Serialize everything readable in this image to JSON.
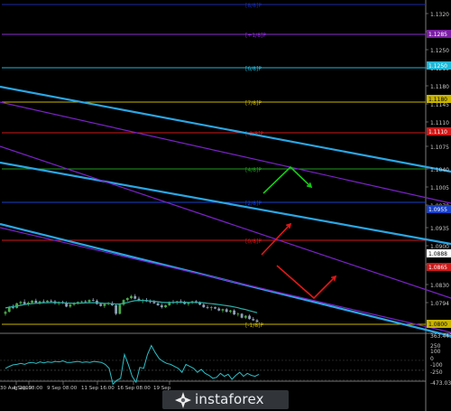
{
  "chart_data": [
    {
      "type": "candlestick",
      "title": "",
      "ylim": [
        1.0794,
        1.3325
      ],
      "price_ticks": [
        "1.1320",
        "1.1285",
        "1.1250",
        "1.1215",
        "1.1180",
        "1.1145",
        "1.1110",
        "1.1075",
        "1.1040",
        "1.1005",
        "1.0970",
        "1.0935",
        "1.0900",
        "1.0865",
        "1.0830",
        "1.0794"
      ],
      "price_marks": [
        {
          "label": "1.1285",
          "color": "#7a1fa2"
        },
        {
          "label": "1.1250",
          "color": "#22b7d6"
        },
        {
          "label": "1.1180",
          "color": "#c8b400"
        },
        {
          "label": "1.1110",
          "color": "#d01818"
        },
        {
          "label": "1.0955",
          "color": "#1740c8"
        },
        {
          "label": "1.0888",
          "color": "#ffffff"
        },
        {
          "label": "1.0865",
          "color": "#d01818"
        },
        {
          "label": "1.0800",
          "color": "#c8b400"
        }
      ],
      "murrey_levels": [
        {
          "label": "[8/8]P",
          "price": 1.3325,
          "color": "#1a2aa0"
        },
        {
          "label": "[+1/8]P",
          "price": 1.1285,
          "color": "#8a2bd0"
        },
        {
          "label": "[6/8]P",
          "price": 1.125,
          "color": "#22b7d6"
        },
        {
          "label": "[7/8]P",
          "price": 1.118,
          "color": "#c8b400"
        },
        {
          "label": "[-2/8]P",
          "price": 1.111,
          "color": "#d01818"
        },
        {
          "label": "[4/8]P",
          "price": 1.104,
          "color": "#1f9a1f"
        },
        {
          "label": "[2/8]P",
          "price": 1.0955,
          "color": "#1740c8"
        },
        {
          "label": "[0/8]P",
          "price": 1.0865,
          "color": "#d01818"
        },
        {
          "label": "[-1/8]P",
          "price": 1.08,
          "color": "#c8b400"
        }
      ],
      "ohlc": [
        [
          1.095,
          1.0975,
          1.0935,
          1.0965
        ],
        [
          1.0965,
          1.101,
          1.096,
          1.1
        ],
        [
          1.1,
          1.102,
          1.0985,
          1.0995
        ],
        [
          1.0995,
          1.1035,
          1.099,
          1.103
        ],
        [
          1.103,
          1.105,
          1.1015,
          1.104
        ],
        [
          1.104,
          1.106,
          1.102,
          1.1025
        ],
        [
          1.1025,
          1.1045,
          1.101,
          1.1035
        ],
        [
          1.1035,
          1.1055,
          1.1025,
          1.105
        ],
        [
          1.105,
          1.1065,
          1.103,
          1.1035
        ],
        [
          1.1035,
          1.105,
          1.102,
          1.1045
        ],
        [
          1.1045,
          1.106,
          1.103,
          1.104
        ],
        [
          1.104,
          1.1055,
          1.1035,
          1.105
        ],
        [
          1.105,
          1.106,
          1.1035,
          1.1045
        ],
        [
          1.1045,
          1.1055,
          1.102,
          1.103
        ],
        [
          1.103,
          1.1045,
          1.1015,
          1.104
        ],
        [
          1.104,
          1.105,
          1.1025,
          1.1035
        ],
        [
          1.1035,
          1.1045,
          1.1,
          1.1005
        ],
        [
          1.1005,
          1.1025,
          1.0995,
          1.102
        ],
        [
          1.102,
          1.104,
          1.101,
          1.103
        ],
        [
          1.103,
          1.1045,
          1.102,
          1.104
        ],
        [
          1.104,
          1.105,
          1.103,
          1.1045
        ],
        [
          1.1045,
          1.1055,
          1.1035,
          1.104
        ],
        [
          1.104,
          1.106,
          1.103,
          1.1055
        ],
        [
          1.1055,
          1.107,
          1.1045,
          1.105
        ],
        [
          1.105,
          1.106,
          1.102,
          1.1025
        ],
        [
          1.1025,
          1.1035,
          1.1005,
          1.101
        ],
        [
          1.101,
          1.103,
          1.0995,
          1.1025
        ],
        [
          1.1025,
          1.104,
          1.1015,
          1.103
        ],
        [
          1.103,
          1.1045,
          1.101,
          1.1015
        ],
        [
          1.1015,
          1.1025,
          1.094,
          1.095
        ],
        [
          1.095,
          1.103,
          1.0945,
          1.102
        ],
        [
          1.102,
          1.106,
          1.101,
          1.1055
        ],
        [
          1.1055,
          1.1075,
          1.1045,
          1.107
        ],
        [
          1.107,
          1.1095,
          1.106,
          1.1085
        ],
        [
          1.1085,
          1.11,
          1.106,
          1.1065
        ],
        [
          1.1065,
          1.108,
          1.1045,
          1.105
        ],
        [
          1.105,
          1.1065,
          1.103,
          1.1055
        ],
        [
          1.1055,
          1.107,
          1.104,
          1.1045
        ],
        [
          1.1045,
          1.106,
          1.103,
          1.104
        ],
        [
          1.104,
          1.1055,
          1.1025,
          1.103
        ],
        [
          1.103,
          1.1045,
          1.101,
          1.1015
        ],
        [
          1.1015,
          1.103,
          1.099,
          1.1
        ],
        [
          1.1,
          1.102,
          1.0995,
          1.1015
        ],
        [
          1.1015,
          1.1045,
          1.101,
          1.104
        ],
        [
          1.104,
          1.1055,
          1.1025,
          1.1035
        ],
        [
          1.1035,
          1.105,
          1.102,
          1.1045
        ],
        [
          1.1045,
          1.106,
          1.103,
          1.104
        ],
        [
          1.104,
          1.105,
          1.102,
          1.1025
        ],
        [
          1.1025,
          1.104,
          1.101,
          1.1035
        ],
        [
          1.1035,
          1.105,
          1.1025,
          1.1045
        ],
        [
          1.1045,
          1.1055,
          1.103,
          1.1035
        ],
        [
          1.1035,
          1.1045,
          1.1015,
          1.102
        ],
        [
          1.102,
          1.103,
          1.0995,
          1.1
        ],
        [
          1.1,
          1.1015,
          1.0985,
          1.0995
        ],
        [
          1.0995,
          1.101,
          1.0975,
          1.1
        ],
        [
          1.1,
          1.1005,
          1.0985,
          1.099
        ],
        [
          1.099,
          1.1,
          1.097,
          1.0975
        ],
        [
          1.0975,
          1.099,
          1.096,
          1.0985
        ],
        [
          1.0985,
          1.0995,
          1.096,
          1.0965
        ],
        [
          1.0965,
          1.098,
          1.0955,
          1.0975
        ],
        [
          1.0975,
          1.0985,
          1.094,
          1.0945
        ],
        [
          1.0945,
          1.096,
          1.093,
          1.095
        ],
        [
          1.095,
          1.0955,
          1.0915,
          1.092
        ],
        [
          1.092,
          1.094,
          1.091,
          1.0935
        ],
        [
          1.0935,
          1.0945,
          1.0905,
          1.091
        ],
        [
          1.091,
          1.0925,
          1.0895,
          1.09
        ],
        [
          1.09,
          1.091,
          1.0885,
          1.0888
        ]
      ],
      "moving_average": [
        1.0995,
        1.1,
        1.1005,
        1.101,
        1.1015,
        1.102,
        1.1025,
        1.1028,
        1.103,
        1.1032,
        1.1034,
        1.1035,
        1.1036,
        1.1036,
        1.1035,
        1.1034,
        1.1032,
        1.1031,
        1.103,
        1.1031,
        1.1032,
        1.1033,
        1.1034,
        1.1035,
        1.1034,
        1.1032,
        1.103,
        1.1029,
        1.1027,
        1.1024,
        1.1025,
        1.103,
        1.1036,
        1.1044,
        1.105,
        1.1052,
        1.1052,
        1.105,
        1.1048,
        1.1045,
        1.1042,
        1.1038,
        1.1036,
        1.1036,
        1.1037,
        1.1038,
        1.1039,
        1.1038,
        1.1037,
        1.1037,
        1.1037,
        1.1036,
        1.1034,
        1.103,
        1.1027,
        1.1024,
        1.102,
        1.1016,
        1.1012,
        1.1008,
        1.1002,
        1.0996,
        1.0988,
        1.0982,
        1.0974,
        1.0966,
        1.0958
      ],
      "channels": [
        {
          "color": "#2aa6e4",
          "points": [
            [
              1.1165,
              0
            ],
            [
              1.103,
              1
            ]
          ]
        },
        {
          "color": "#2aa6e4",
          "points": [
            [
              1.104,
              0
            ],
            [
              1.09,
              1
            ]
          ]
        },
        {
          "color": "#2aa6e4",
          "points": [
            [
              1.094,
              0
            ],
            [
              1.078,
              1
            ]
          ]
        },
        {
          "color": "#7a22c8",
          "points": [
            [
              1.114,
              0
            ],
            [
              1.101,
              1
            ]
          ]
        },
        {
          "color": "#7a22c8",
          "points": [
            [
              1.101,
              0
            ],
            [
              1.0875,
              1
            ]
          ]
        },
        {
          "color": "#7a22c8",
          "points": [
            [
              1.0915,
              0
            ],
            [
              1.0795,
              1
            ]
          ]
        }
      ],
      "arrows": [
        {
          "color": "#18c818",
          "points": [
            [
              0,
              1.0955
            ],
            [
              1,
              1.1035
            ],
            [
              2,
              1.1
            ]
          ]
        },
        {
          "color": "#e01818",
          "points": [
            [
              0,
              1.0888
            ],
            [
              1,
              1.092
            ]
          ]
        },
        {
          "color": "#e01818",
          "points": [
            [
              0,
              1.0865
            ],
            [
              1,
              1.081
            ],
            [
              2,
              1.0845
            ]
          ]
        }
      ]
    },
    {
      "type": "line",
      "title": "",
      "ylim": [
        -473.0301,
        363.4436
      ],
      "ticks": [
        "363.4436",
        "250",
        "100",
        "0",
        "-100",
        "-250",
        "-473.0301"
      ],
      "values": [
        20,
        40,
        55,
        60,
        70,
        60,
        75,
        80,
        70,
        85,
        75,
        85,
        80,
        90,
        85,
        95,
        80,
        80,
        85,
        90,
        80,
        85,
        80,
        90,
        85,
        80,
        60,
        20,
        -140,
        -100,
        -80,
        160,
        60,
        -60,
        -120,
        30,
        20,
        160,
        250,
        180,
        120,
        90,
        70,
        60,
        40,
        20,
        -20,
        60,
        40,
        20,
        -20,
        10,
        -30,
        -50,
        -80,
        -70,
        -30,
        -60,
        -40,
        -90,
        -50,
        -20,
        -60,
        -30,
        -50,
        -60,
        -40
      ]
    }
  ],
  "time_axis": [
    "30 Aug 2019",
    "4 Sep 08:00",
    "9 Sep 08:00",
    "11 Sep 16:00",
    "16 Sep 08:00",
    "19 Sep"
  ],
  "watermark": {
    "label": "instaforex",
    "logo_colors": [
      "#ffffff",
      "#ffffff"
    ]
  }
}
